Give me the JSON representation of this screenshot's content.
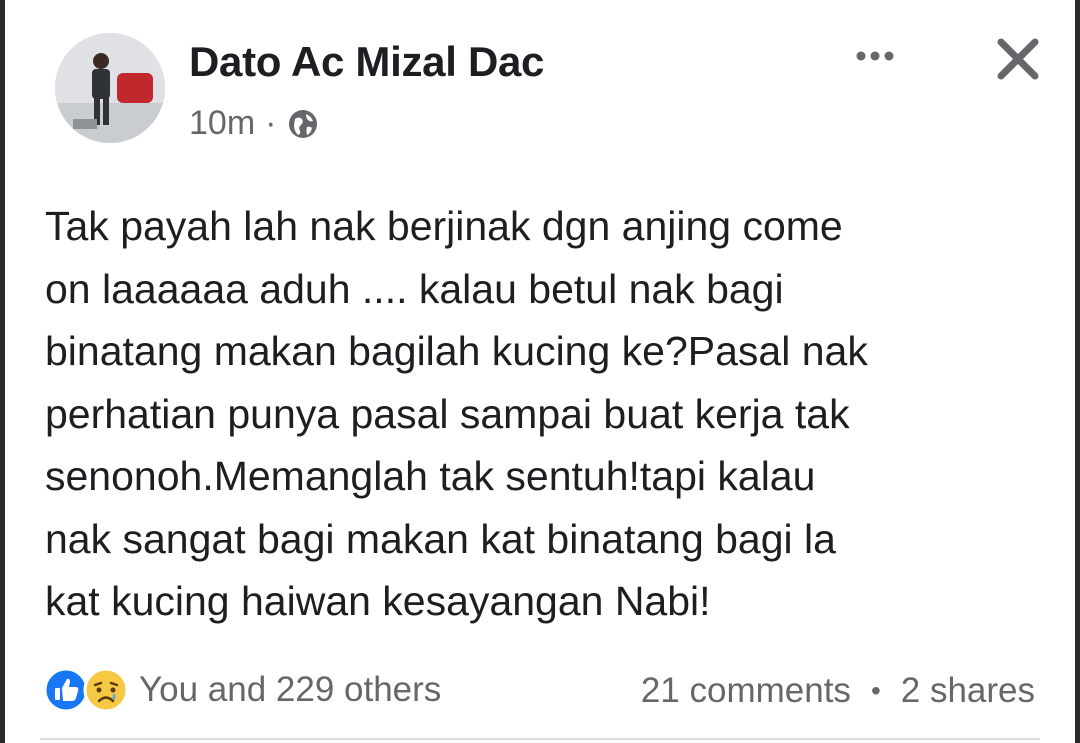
{
  "post": {
    "author": "Dato Ac Mizal Dac",
    "time": "10m",
    "separator": "·",
    "audience_icon": "globe-icon",
    "more_icon": "ellipsis-icon",
    "close_icon": "close-icon",
    "text": "Tak payah lah nak berjinak dgn anjing come\non laaaaaa aduh .... kalau betul nak bagi\nbinatang makan bagilah kucing ke?Pasal nak\nperhatian punya pasal sampai buat kerja tak\nsenonoh.Memanglah tak sentuh!tapi kalau\nnak sangat bagi makan kat binatang bagi la\nkat kucing haiwan kesayangan Nabi!"
  },
  "footer": {
    "reaction_icons": [
      "like-icon",
      "sad-icon"
    ],
    "reactions_text": "You and 229 others",
    "comments": "21 comments",
    "bullet": "•",
    "shares": "2 shares"
  },
  "colors": {
    "text": "#1c1e21",
    "secondary_text": "#65676b",
    "like_blue": "#1877f2",
    "sad_yellow": "#f7c843"
  }
}
